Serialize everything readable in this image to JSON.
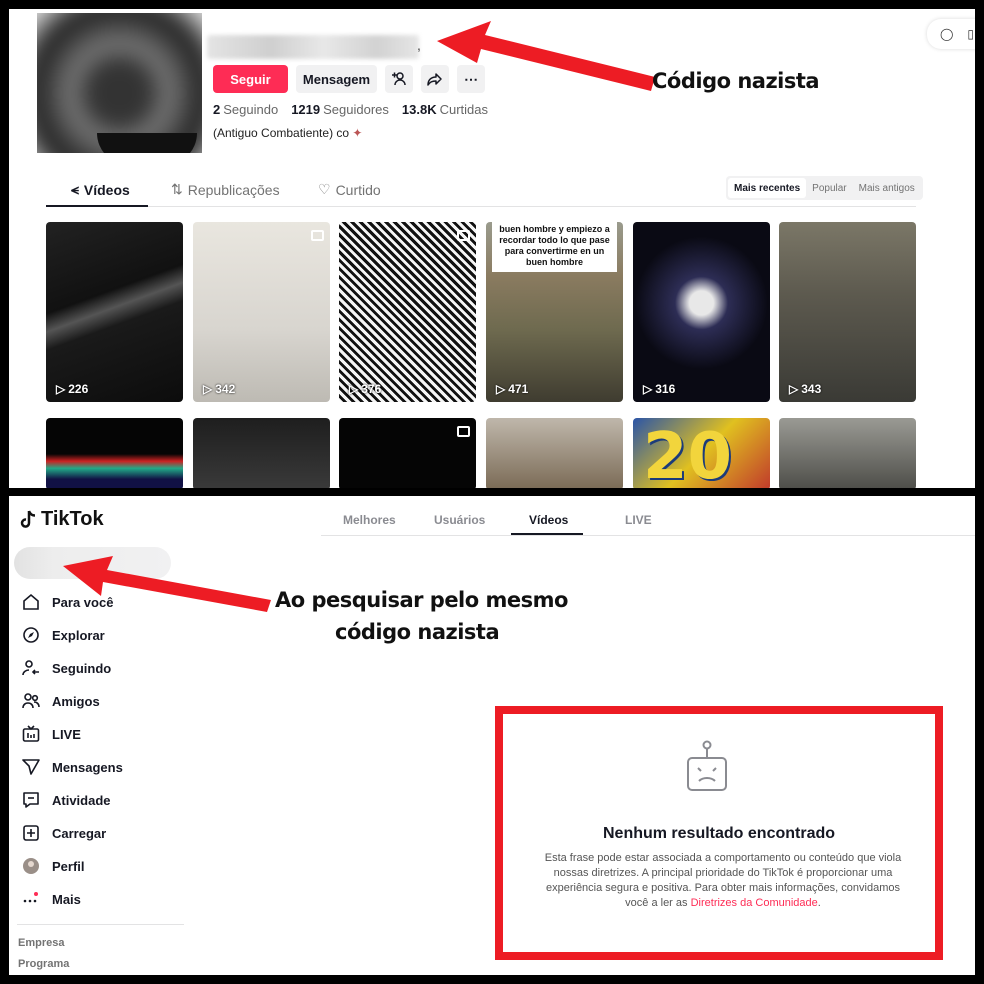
{
  "profile": {
    "buttons": {
      "follow": "Seguir",
      "message": "Mensagem"
    },
    "stats": {
      "following_count": "2",
      "following_label": "Seguindo",
      "followers_count": "1219",
      "followers_label": "Seguidores",
      "likes_count": "13.8K",
      "likes_label": "Curtidas"
    },
    "bio": "(Antiguo Combatiente) co",
    "tabs": [
      "Vídeos",
      "Republicações",
      "Curtido"
    ],
    "sort": [
      "Mais recentes",
      "Popular",
      "Mais antigos"
    ],
    "videos": [
      {
        "views": "226"
      },
      {
        "views": "342"
      },
      {
        "views": "376"
      },
      {
        "views": "471",
        "caption": "buen hombre y empiezo a recordar todo lo que pase para convertirme en un buen hombre"
      },
      {
        "views": "316"
      },
      {
        "views": "343"
      }
    ],
    "second_row_text": "20"
  },
  "annotations": {
    "top": "Código nazista",
    "bottom_line1": "Ao pesquisar pelo mesmo",
    "bottom_line2": "código nazista"
  },
  "search": {
    "logo": "TikTok",
    "nav": [
      "Para você",
      "Explorar",
      "Seguindo",
      "Amigos",
      "LIVE",
      "Mensagens",
      "Atividade",
      "Carregar",
      "Perfil",
      "Mais"
    ],
    "footer": [
      "Empresa",
      "Programa"
    ],
    "tabs": [
      "Melhores",
      "Usuários",
      "Vídeos",
      "LIVE"
    ],
    "empty_title": "Nenhum resultado encontrado",
    "empty_text": "Esta frase pode estar associada a comportamento ou conteúdo que viola nossas diretrizes. A principal prioridade do TikTok é proporcionar uma experiência segura e positiva. Para obter mais informações, convidamos você a ler as",
    "empty_link": "Diretrizes da Comunidade",
    "empty_end": "."
  },
  "colors": {
    "brand": "#fe2c55",
    "annotation_red": "#ed1c24"
  }
}
